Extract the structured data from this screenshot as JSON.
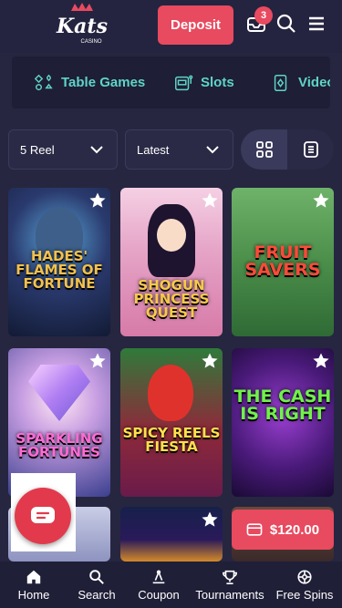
{
  "header": {
    "logo_text": "Kats",
    "logo_sub": "CASINO",
    "deposit_label": "Deposit",
    "notification_count": "3"
  },
  "categories": [
    {
      "label": "Table Games",
      "icon": "cards-icon"
    },
    {
      "label": "Slots",
      "icon": "slot-machine-icon"
    },
    {
      "label": "Video",
      "icon": "video-poker-icon"
    }
  ],
  "filters": {
    "reel_value": "5 Reel",
    "sort_value": "Latest"
  },
  "games": [
    {
      "title": "HADES' FLAMES OF FORTUNE"
    },
    {
      "title": "SHOGUN PRINCESS QUEST"
    },
    {
      "title": "FRUIT SAVERS"
    },
    {
      "title": "SPARKLING FORTUNES"
    },
    {
      "title": "SPICY REELS FIESTA"
    },
    {
      "title": "THE CASH IS RIGHT"
    }
  ],
  "balance": "$120.00",
  "bottom_nav": [
    {
      "label": "Home",
      "icon": "home-icon"
    },
    {
      "label": "Search",
      "icon": "search-icon"
    },
    {
      "label": "Coupon",
      "icon": "coupon-icon"
    },
    {
      "label": "Tournaments",
      "icon": "trophy-icon"
    },
    {
      "label": "Free Spins",
      "icon": "free-spins-icon"
    }
  ],
  "colors": {
    "background": "#262640",
    "accent": "#e84a5f",
    "category_text": "#5fd4c6"
  }
}
